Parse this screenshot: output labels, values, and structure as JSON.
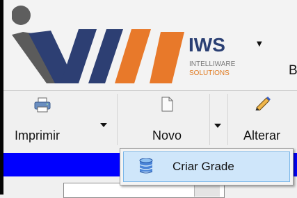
{
  "brand": {
    "name": "IWS",
    "line1": "INTELLIWARE",
    "line2": "SOLUTIONS",
    "partial_text": "B",
    "colors": {
      "navy": "#2a3f73",
      "orange": "#e8792a",
      "gray": "#7a7a7a"
    }
  },
  "toolbar": {
    "buttons": [
      {
        "label": "Imprimir",
        "icon": "printer-icon",
        "has_dropdown": true
      },
      {
        "label": "Novo",
        "icon": "new-document-icon",
        "has_dropdown": true
      },
      {
        "label": "Alterar",
        "icon": "pencil-icon",
        "has_dropdown": false
      }
    ]
  },
  "dropdown_menu": {
    "items": [
      {
        "label": "Criar Grade",
        "icon": "database-icon",
        "highlighted": true
      }
    ]
  },
  "colors": {
    "header_bar": "#0000ff",
    "menu_highlight": "#cfe6fa"
  }
}
